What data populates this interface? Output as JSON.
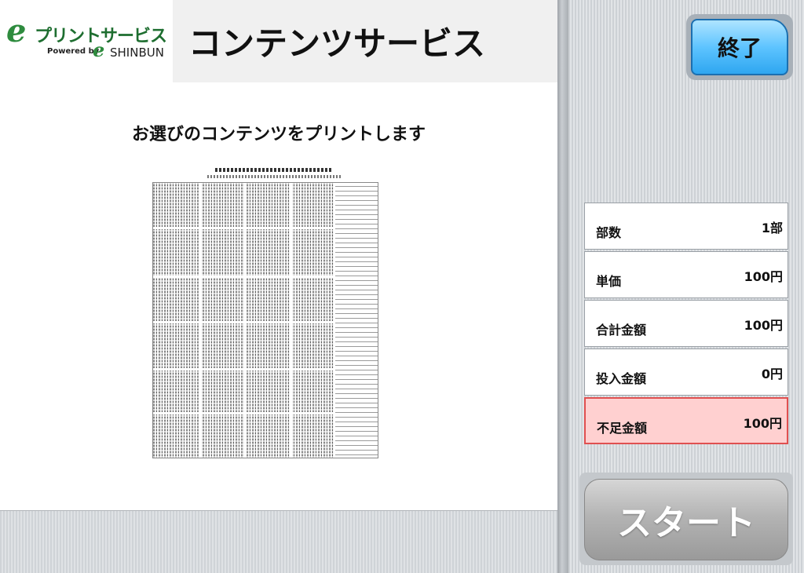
{
  "header": {
    "logo": {
      "e_mark": "e",
      "service_name": "プリントサービス",
      "powered_by": "Powered by",
      "e_mark_small": "e",
      "brand": "SHINBUN"
    },
    "title": "コンテンツサービス"
  },
  "main": {
    "instruction": "お選びのコンテンツをプリントします"
  },
  "right_panel": {
    "end_button_label": "終了",
    "info": [
      {
        "label": "部数",
        "value": "1部"
      },
      {
        "label": "単価",
        "value": "100円"
      },
      {
        "label": "合計金額",
        "value": "100円"
      },
      {
        "label": "投入金額",
        "value": "0円"
      },
      {
        "label": "不足金額",
        "value": "100円"
      }
    ],
    "start_button_label": "スタート"
  },
  "colors": {
    "accent_blue": "#5ec4ff",
    "logo_green": "#2e8b3e",
    "shortage_bg": "#ffd0d0",
    "shortage_border": "#e05050"
  }
}
